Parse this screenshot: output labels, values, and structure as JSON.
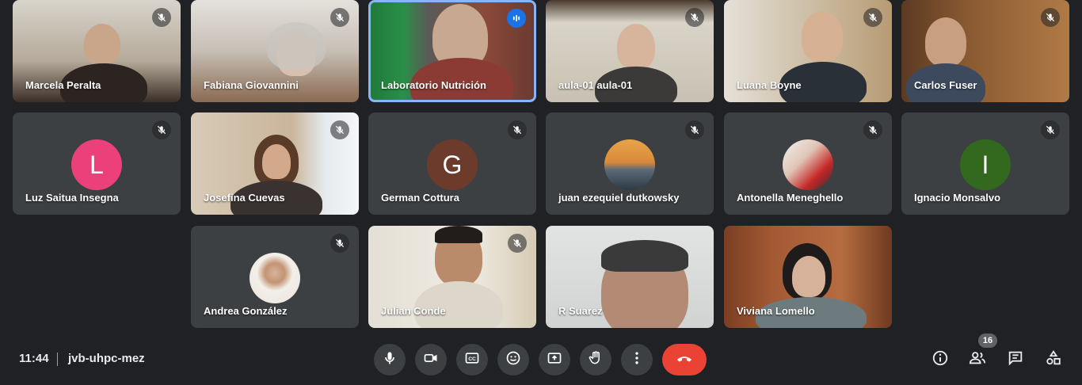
{
  "participants": [
    {
      "name": "Marcela Peralta"
    },
    {
      "name": "Fabiana Giovannini"
    },
    {
      "name": "Laboratorio Nutrición"
    },
    {
      "name": "aula-01 aula-01"
    },
    {
      "name": "Luana Boyne"
    },
    {
      "name": "Carlos Fuser"
    },
    {
      "name": "Luz Saitua Insegna",
      "initial": "L"
    },
    {
      "name": "Josefina Cuevas"
    },
    {
      "name": "German Cottura",
      "initial": "G"
    },
    {
      "name": "juan ezequiel dutkowsky"
    },
    {
      "name": "Antonella Meneghello"
    },
    {
      "name": "Ignacio Monsalvo",
      "initial": "I"
    },
    {
      "name": "Andrea González"
    },
    {
      "name": "Julian Conde"
    },
    {
      "name": "R Suarez"
    },
    {
      "name": "Viviana Lomello"
    }
  ],
  "colors": {
    "background": "#202124",
    "tile": "#3c4043",
    "active_border": "#8ab4f8",
    "hangup": "#ea4335",
    "avatar_L": "#ec407a",
    "avatar_G": "#6d3b2c",
    "avatar_I": "#33691e"
  },
  "bottom_bar": {
    "time": "11:44",
    "meeting_code": "jvb-uhpc-mez",
    "controls": [
      "mic-icon",
      "camera-icon",
      "captions-icon",
      "emoji-icon",
      "present-icon",
      "raise-hand-icon",
      "more-options-icon",
      "hang-up-icon"
    ],
    "right_icons": [
      "info-icon",
      "people-icon",
      "chat-icon",
      "activities-icon"
    ],
    "people_count": "16"
  }
}
